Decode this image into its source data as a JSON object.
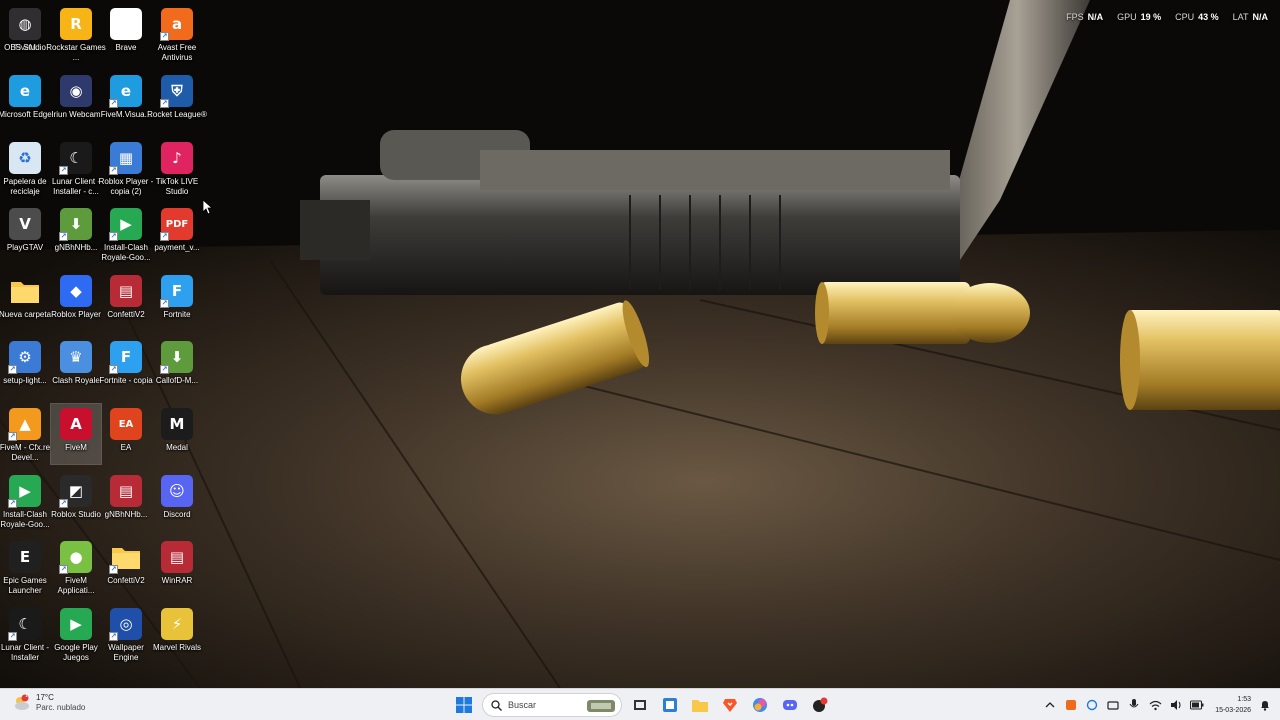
{
  "desktop": {
    "icons": [
      {
        "label": "FiveM",
        "icon": "winrar-icon",
        "color": "#b72b37"
      },
      {
        "label": "Microsoft Edge",
        "icon": "edge-icon",
        "color": "#1f9be0"
      },
      {
        "label": "Papelera de reciclaje",
        "icon": "recycle-bin-icon",
        "color": "#d9e7f3"
      },
      {
        "label": "PlayGTAV",
        "icon": "gta-icon",
        "color": "#4c4c4c"
      },
      {
        "label": "Nueva carpeta",
        "icon": "folder-icon",
        "color": "#f7c84a"
      },
      {
        "label": "setup-light...",
        "icon": "installer-icon",
        "color": "#3b7bd6"
      },
      {
        "label": "FiveM - Cfx.re Devel...",
        "icon": "fivem-icon",
        "color": "#f39a1e"
      },
      {
        "label": "Install-Clash Royale-Goo...",
        "icon": "google-play-icon",
        "color": "#27a852"
      },
      {
        "label": "Epic Games Launcher",
        "icon": "epic-games-icon",
        "color": "#202020"
      },
      {
        "label": "Lunar Client - Installer",
        "icon": "lunar-client-icon",
        "color": "#1a1a1a"
      },
      {
        "label": "Rockstar Games ...",
        "icon": "rockstar-icon",
        "color": "#f6b417"
      },
      {
        "label": "Iriun Webcam",
        "icon": "webcam-icon",
        "color": "#2d3a6b"
      },
      {
        "label": "Lunar Client - Installer - c...",
        "icon": "lunar-client-icon",
        "color": "#1a1a1a"
      },
      {
        "label": "gNBhNHb...",
        "icon": "torrent-icon",
        "color": "#5d9b3c"
      },
      {
        "label": "Roblox Player",
        "icon": "roblox-icon",
        "color": "#2f6bf2"
      },
      {
        "label": "Clash Royale",
        "icon": "clash-royale-icon",
        "color": "#4b8fe0"
      },
      {
        "label": "FiveM",
        "icon": "adobe-icon",
        "color": "#c8102e"
      },
      {
        "label": "Roblox Studio",
        "icon": "roblox-studio-icon",
        "color": "#2a2a2a"
      },
      {
        "label": "FiveM Applicati...",
        "icon": "fivem-app-icon",
        "color": "#7ac143"
      },
      {
        "label": "Google Play Juegos",
        "icon": "google-play-icon",
        "color": "#27a852"
      },
      {
        "label": "Brave",
        "icon": "file-icon",
        "color": "#ffffff"
      },
      {
        "label": "FiveM.Visua...",
        "icon": "edge-icon",
        "color": "#1f9be0"
      },
      {
        "label": "Roblox Player - copia (2)",
        "icon": "window-icon",
        "color": "#3a7bd5"
      },
      {
        "label": "Install-Clash Royale-Goo...",
        "icon": "google-play-icon",
        "color": "#27a852"
      },
      {
        "label": "ConfettiV2",
        "icon": "winrar-icon",
        "color": "#b72b37"
      },
      {
        "label": "Fortnite - copia",
        "icon": "fortnite-icon",
        "color": "#2ea0f0"
      },
      {
        "label": "EA",
        "icon": "ea-icon",
        "color": "#e0441f"
      },
      {
        "label": "gNBhNHb...",
        "icon": "winrar-icon",
        "color": "#b72b37"
      },
      {
        "label": "ConfettiV2",
        "icon": "folder-icon",
        "color": "#f7c84a"
      },
      {
        "label": "Wallpaper Engine",
        "icon": "wallpaper-engine-icon",
        "color": "#1f4fa8"
      },
      {
        "label": "Avast Free Antivirus",
        "icon": "avast-icon",
        "color": "#f26b1d"
      },
      {
        "label": "Rocket League®",
        "icon": "rocket-league-icon",
        "color": "#1e5ba8"
      },
      {
        "label": "TikTok LIVE Studio",
        "icon": "tiktok-icon",
        "color": "#e02461"
      },
      {
        "label": "payment_v...",
        "icon": "pdf-icon",
        "color": "#e23b2e"
      },
      {
        "label": "Fortnite",
        "icon": "fortnite-icon",
        "color": "#2ea0f0"
      },
      {
        "label": "CallofD-M...",
        "icon": "torrent-icon",
        "color": "#5d9b3c"
      },
      {
        "label": "Medal",
        "icon": "medal-icon",
        "color": "#1c1c1c"
      },
      {
        "label": "Discord",
        "icon": "discord-icon",
        "color": "#5865f2"
      },
      {
        "label": "WinRAR",
        "icon": "winrar-icon",
        "color": "#b72b37"
      },
      {
        "label": "Marvel Rivals",
        "icon": "marvel-rivals-icon",
        "color": "#e8c33a"
      },
      {
        "label": "OBS Studio",
        "icon": "obs-icon",
        "color": "#302e31"
      }
    ]
  },
  "osd": {
    "fps_label": "FPS",
    "fps_value": "N/A",
    "gpu_label": "GPU",
    "gpu_value": "19 %",
    "cpu_label": "CPU",
    "cpu_value": "43 %",
    "lat_label": "LAT",
    "lat_value": "N/A"
  },
  "taskbar": {
    "weather_temp": "17°C",
    "weather_status": "Parc. nublado",
    "weather_badge": "1",
    "search_placeholder": "Buscar",
    "clock_time": "1:53",
    "clock_date": "15-03-2026"
  }
}
